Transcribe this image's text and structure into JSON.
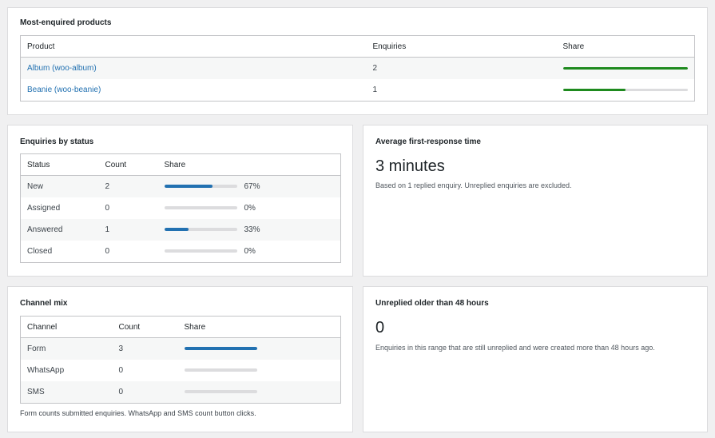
{
  "colors": {
    "product_bar": "#1e8a1e",
    "status_bar": "#2271b1",
    "track": "#dcdcde",
    "link": "#2271b1"
  },
  "most_enquired": {
    "title": "Most-enquired products",
    "columns": [
      "Product",
      "Enquiries",
      "Share"
    ],
    "rows": [
      {
        "product": "Album (woo-album)",
        "enquiries": "2",
        "share": 1.0
      },
      {
        "product": "Beanie (woo-beanie)",
        "enquiries": "1",
        "share": 0.5
      }
    ]
  },
  "by_status": {
    "title": "Enquiries by status",
    "columns": [
      "Status",
      "Count",
      "Share"
    ],
    "rows": [
      {
        "status": "New",
        "count": "2",
        "share": 0.67,
        "pct": "67%"
      },
      {
        "status": "Assigned",
        "count": "0",
        "share": 0,
        "pct": "0%"
      },
      {
        "status": "Answered",
        "count": "1",
        "share": 0.33,
        "pct": "33%"
      },
      {
        "status": "Closed",
        "count": "0",
        "share": 0,
        "pct": "0%"
      }
    ]
  },
  "avg_response": {
    "title": "Average first-response time",
    "value": "3 minutes",
    "description": "Based on 1 replied enquiry. Unreplied enquiries are excluded."
  },
  "channel_mix": {
    "title": "Channel mix",
    "columns": [
      "Channel",
      "Count",
      "Share"
    ],
    "rows": [
      {
        "channel": "Form",
        "count": "3",
        "share": 1.0
      },
      {
        "channel": "WhatsApp",
        "count": "0",
        "share": 0
      },
      {
        "channel": "SMS",
        "count": "0",
        "share": 0
      }
    ],
    "note": "Form counts submitted enquiries. WhatsApp and SMS count button clicks."
  },
  "unreplied": {
    "title": "Unreplied older than 48 hours",
    "value": "0",
    "description": "Enquiries in this range that are still unreplied and were created more than 48 hours ago."
  }
}
